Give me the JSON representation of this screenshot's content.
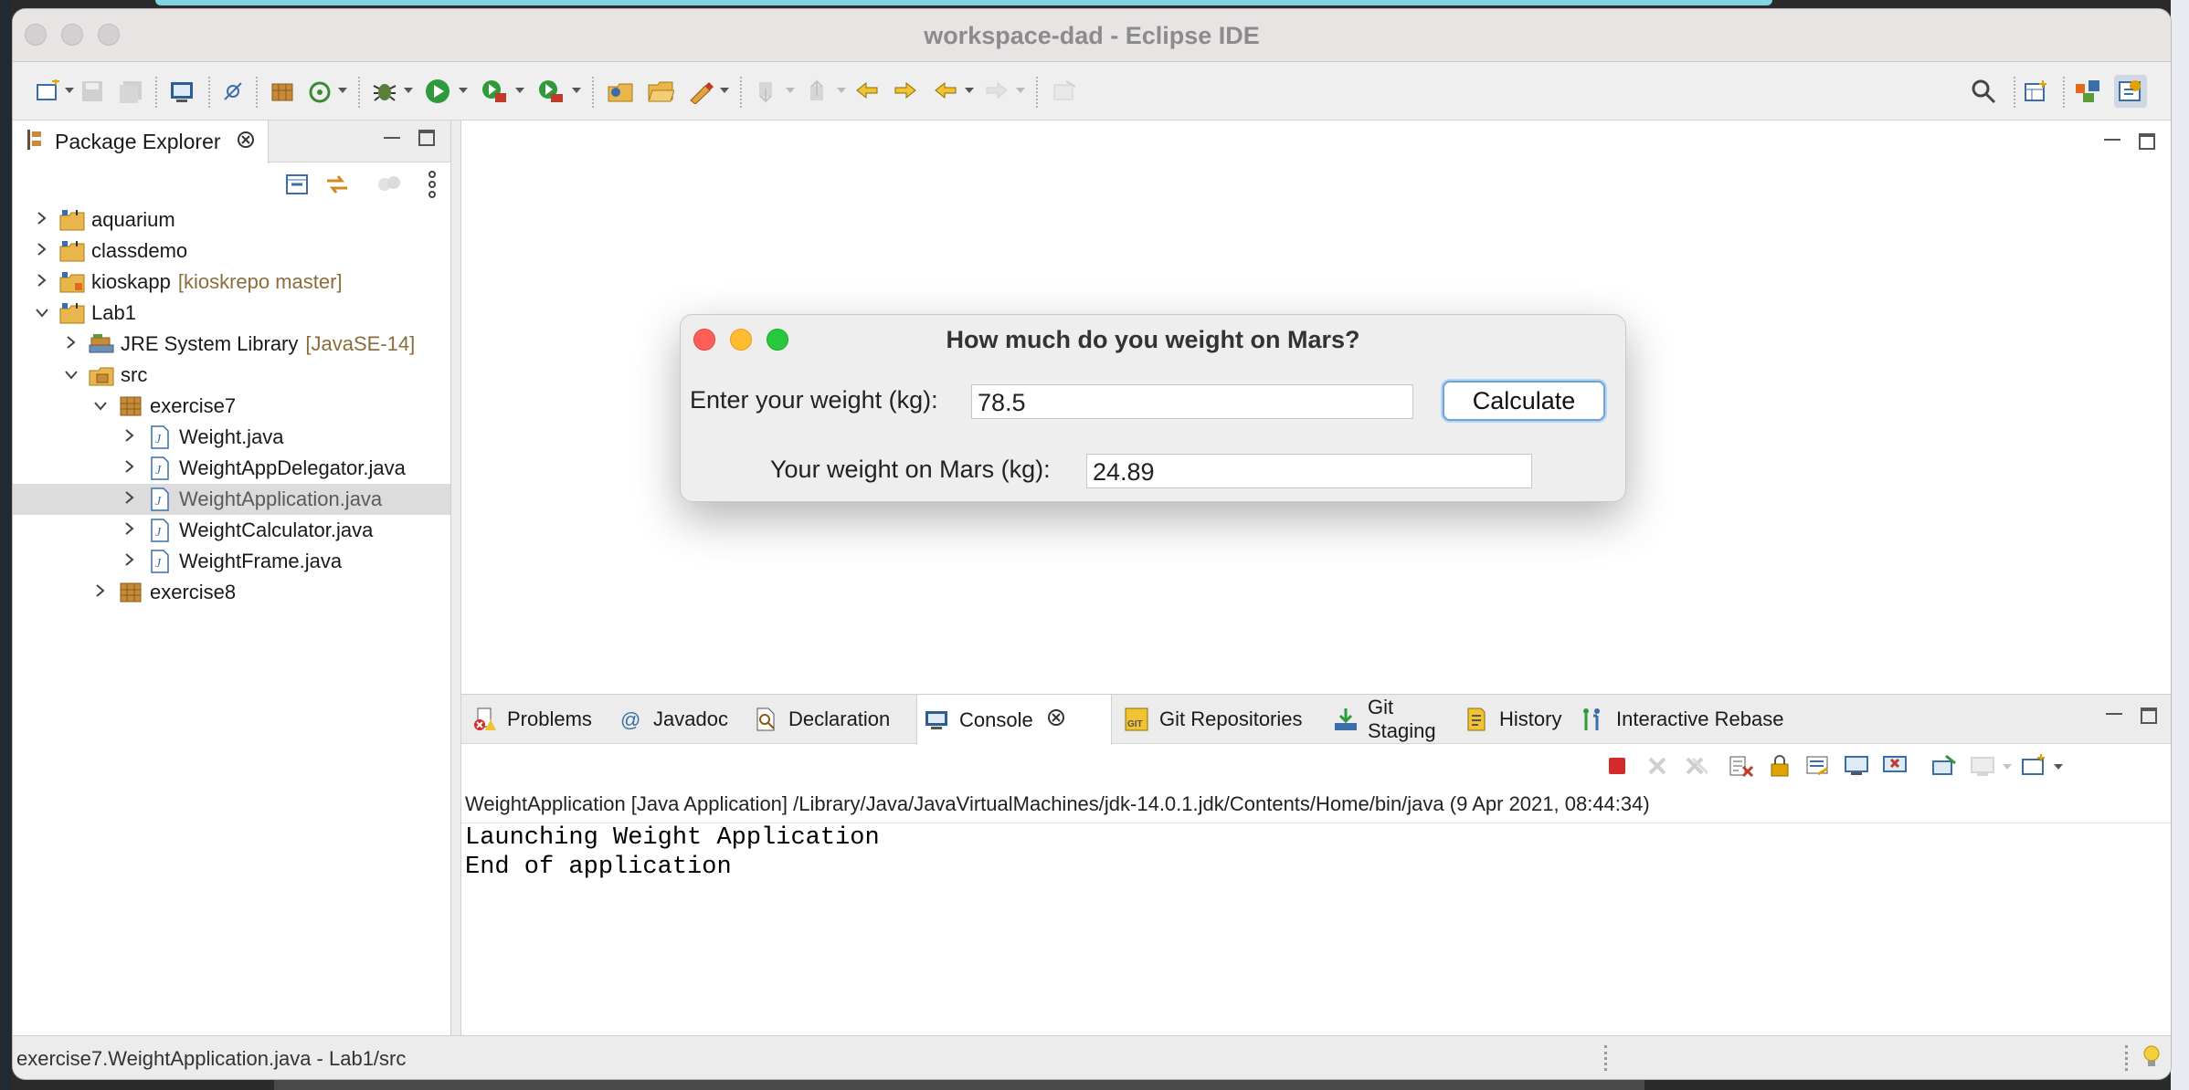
{
  "window": {
    "title": "workspace-dad - Eclipse IDE"
  },
  "package_explorer": {
    "tab_label": "Package Explorer",
    "tree": [
      {
        "label": "aquarium",
        "deco": "",
        "depth": 0,
        "expanded": false,
        "icon": "project-folder-icon"
      },
      {
        "label": "classdemo",
        "deco": "",
        "depth": 0,
        "expanded": false,
        "icon": "project-folder-icon"
      },
      {
        "label": "kioskapp",
        "deco": "[kioskrepo master]",
        "depth": 0,
        "expanded": false,
        "icon": "git-project-icon"
      },
      {
        "label": "Lab1",
        "deco": "",
        "depth": 0,
        "expanded": true,
        "icon": "project-folder-icon"
      },
      {
        "label": "JRE System Library",
        "deco": "[JavaSE-14]",
        "depth": 1,
        "expanded": false,
        "icon": "library-icon"
      },
      {
        "label": "src",
        "deco": "",
        "depth": 1,
        "expanded": true,
        "icon": "source-folder-icon"
      },
      {
        "label": "exercise7",
        "deco": "",
        "depth": 2,
        "expanded": true,
        "icon": "package-icon"
      },
      {
        "label": "Weight.java",
        "deco": "",
        "depth": 3,
        "expanded": false,
        "icon": "java-file-icon"
      },
      {
        "label": "WeightAppDelegator.java",
        "deco": "",
        "depth": 3,
        "expanded": false,
        "icon": "java-file-icon"
      },
      {
        "label": "WeightApplication.java",
        "deco": "",
        "depth": 3,
        "expanded": false,
        "icon": "java-file-icon",
        "selected": true
      },
      {
        "label": "WeightCalculator.java",
        "deco": "",
        "depth": 3,
        "expanded": false,
        "icon": "java-file-icon"
      },
      {
        "label": "WeightFrame.java",
        "deco": "",
        "depth": 3,
        "expanded": false,
        "icon": "java-file-icon"
      },
      {
        "label": "exercise8",
        "deco": "",
        "depth": 2,
        "expanded": false,
        "icon": "package-icon"
      }
    ]
  },
  "dialog": {
    "title": "How much do you weight on Mars?",
    "weight_label": "Enter your weight (kg):",
    "weight_value": "78.5",
    "calculate_label": "Calculate",
    "result_label": "Your weight on Mars (kg):",
    "result_value": "24.89"
  },
  "bottom_panel": {
    "tabs": [
      {
        "label": "Problems",
        "icon": "problems-icon"
      },
      {
        "label": "Javadoc",
        "icon": "javadoc-icon"
      },
      {
        "label": "Declaration",
        "icon": "declaration-icon"
      },
      {
        "label": "Console",
        "icon": "console-icon",
        "active": true
      },
      {
        "label": "Git Repositories",
        "icon": "git-repositories-icon"
      },
      {
        "label": "Git Staging",
        "icon": "git-staging-icon"
      },
      {
        "label": "History",
        "icon": "history-icon"
      },
      {
        "label": "Interactive Rebase",
        "icon": "interactive-rebase-icon"
      }
    ],
    "console_header": "WeightApplication [Java Application] /Library/Java/JavaVirtualMachines/jdk-14.0.1.jdk/Contents/Home/bin/java  (9 Apr 2021, 08:44:34)",
    "console_lines": [
      "Launching Weight Application",
      "End of application"
    ]
  },
  "status_bar": {
    "text": "exercise7.WeightApplication.java - Lab1/src"
  },
  "colors": {
    "close": "#ff5f57",
    "minimize": "#febc2e",
    "zoom": "#28c840",
    "deco": "#8a6d3b",
    "selection": "#dcdcdc",
    "focus_ring": "#6aa2dc"
  }
}
